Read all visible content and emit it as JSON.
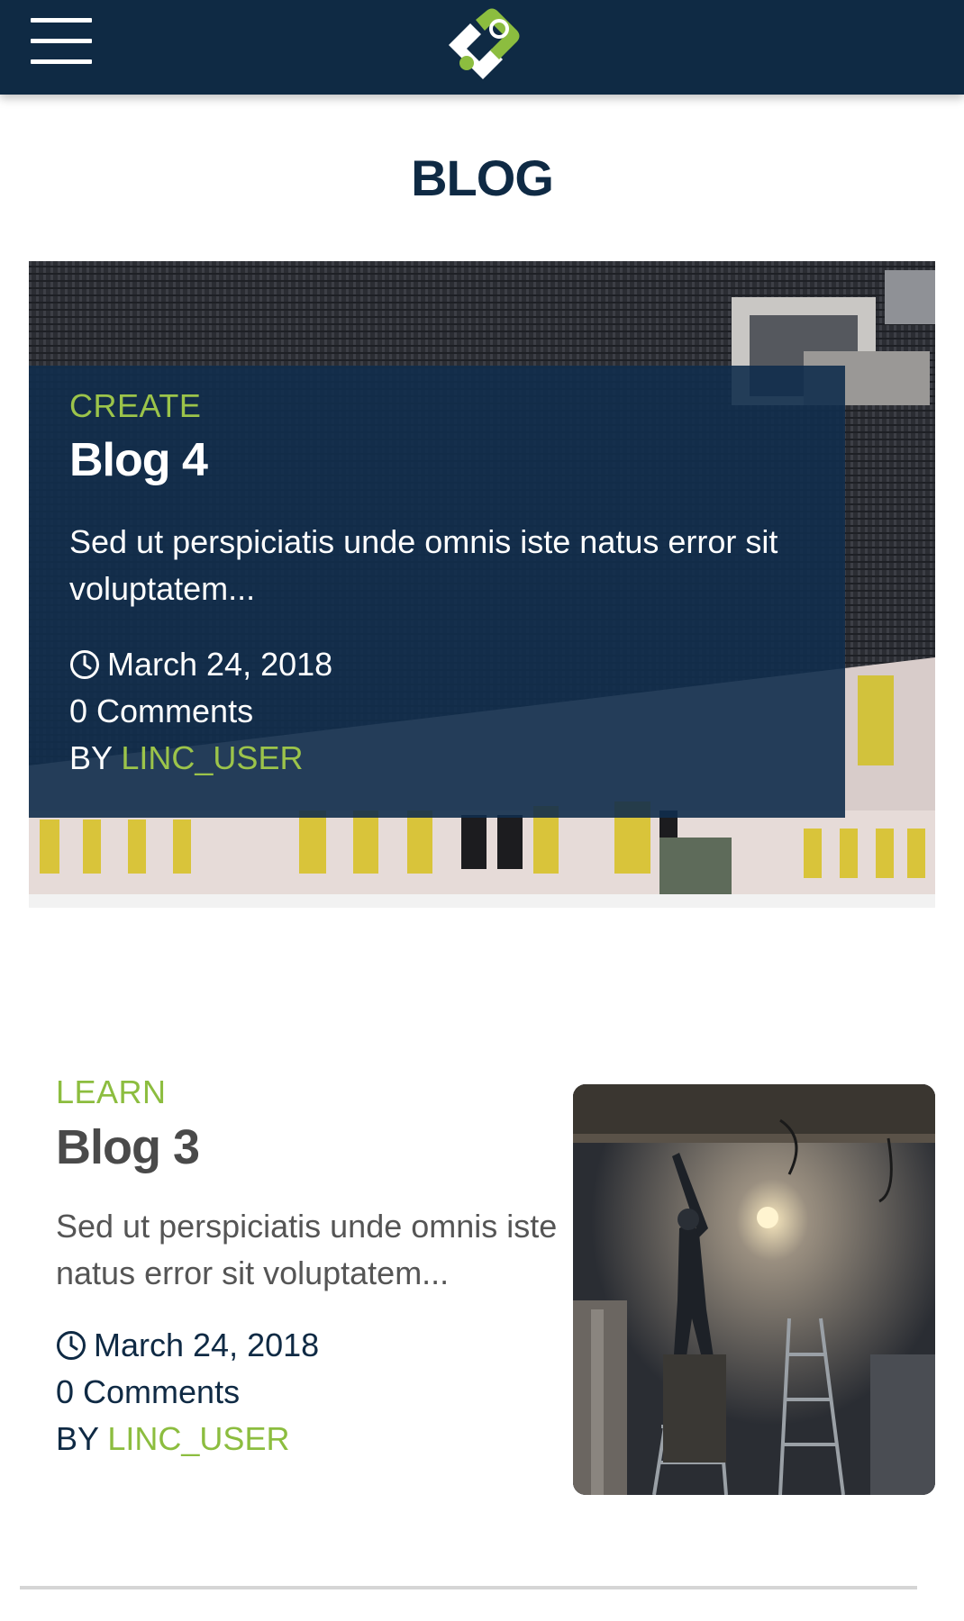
{
  "header": {
    "menu_icon": "hamburger-menu-icon",
    "logo_icon": "brand-logo-icon",
    "colors": {
      "bar": "#0f2a44",
      "logo_green": "#8cbd3f",
      "logo_white": "#ffffff"
    }
  },
  "page": {
    "title": "BLOG"
  },
  "featured_post": {
    "category": "CREATE",
    "title": "Blog 4",
    "excerpt": "Sed ut perspiciatis unde omnis iste natus error sit voluptatem...",
    "date": "March 24, 2018",
    "comments": "0 Comments",
    "by_label": "BY",
    "author": "LINC_USER",
    "image": "building-facade-photo"
  },
  "post": {
    "category": "LEARN",
    "title": "Blog 3",
    "excerpt": "Sed ut perspiciatis unde omnis iste natus error sit voluptatem...",
    "date": "March 24, 2018",
    "comments": "0 Comments",
    "by_label": "BY",
    "author": "LINC_USER",
    "image": "construction-worker-photo"
  },
  "colors": {
    "accent": "#8cbd3f",
    "navy": "#0f2a44",
    "text_gray": "#4a4a4a"
  }
}
